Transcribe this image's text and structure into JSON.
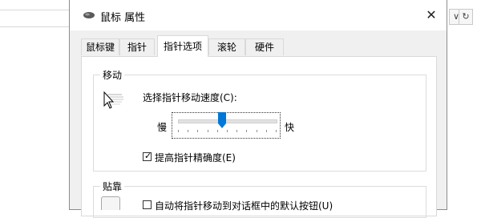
{
  "dialog": {
    "title": "鼠标 属性",
    "close_glyph": "✕"
  },
  "tabs": [
    {
      "label": "鼠标键"
    },
    {
      "label": "指针"
    },
    {
      "label": "指针选项",
      "active": true
    },
    {
      "label": "滚轮"
    },
    {
      "label": "硬件"
    }
  ],
  "motion": {
    "group_label": "移动",
    "speed_label": "选择指针移动速度(C):",
    "slow_label": "慢",
    "fast_label": "快",
    "speed_fraction": 0.45,
    "precision_label": "提高指针精确度(E)",
    "precision_checked": true
  },
  "snap": {
    "group_label": "贴靠",
    "snap_label": "自动将指针移动到对话框中的默认按钮(U)",
    "snap_checked": false
  },
  "background": {
    "dropdown_glyph": "∨",
    "refresh_glyph": "↻"
  },
  "colors": {
    "accent": "#0078d7",
    "dialog_bg": "#f0f0f0",
    "panel_bg": "#ffffff"
  },
  "icons": {
    "title": "mouse-icon",
    "motion": "pointer-motion-icon",
    "snap": "snap-to-icon",
    "close": "close-icon",
    "dropdown": "chevron-down-icon",
    "refresh": "refresh-icon"
  }
}
